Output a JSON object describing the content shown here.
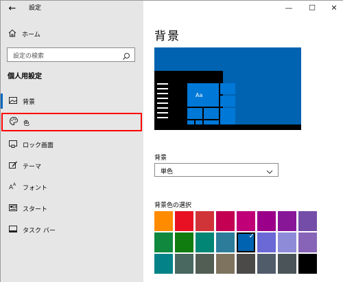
{
  "window": {
    "title": "設定",
    "back_glyph": "←",
    "controls": {
      "minimize": "—",
      "maximize": "☐",
      "close": "✕"
    }
  },
  "sidebar": {
    "home": {
      "label": "ホーム",
      "icon": "home-icon"
    },
    "search": {
      "placeholder": "設定の検索",
      "icon": "search-icon"
    },
    "section_title": "個人用設定",
    "items": [
      {
        "label": "背景",
        "icon": "picture-icon",
        "selected": true
      },
      {
        "label": "色",
        "icon": "palette-icon",
        "highlighted": true
      },
      {
        "label": "ロック画面",
        "icon": "lock-screen-icon"
      },
      {
        "label": "テーマ",
        "icon": "theme-brush-icon"
      },
      {
        "label": "フォント",
        "icon": "font-icon"
      },
      {
        "label": "スタート",
        "icon": "start-icon"
      },
      {
        "label": "タスク バー",
        "icon": "taskbar-icon"
      }
    ]
  },
  "main": {
    "page_title": "背景",
    "preview": {
      "tile_text": "Aa"
    },
    "background": {
      "label": "背景",
      "value": "単色",
      "icon": "chevron-down-icon"
    },
    "colors": {
      "label": "背景色の選択",
      "selected_index": 12,
      "swatches": [
        "#ff8c00",
        "#e81123",
        "#d13438",
        "#c30052",
        "#bf0077",
        "#9a0089",
        "#881798",
        "#744da9",
        "#10893e",
        "#107c10",
        "#018574",
        "#2d7d9a",
        "#0063b1",
        "#6b69d6",
        "#8e8cd8",
        "#8764b8",
        "#038387",
        "#486860",
        "#525e54",
        "#7e735f",
        "#4c4a48",
        "#515c6b",
        "#4a5459",
        "#000000"
      ]
    }
  },
  "colors": {
    "sidebar_bg": "#e6e6e6",
    "accent": "#0063b1",
    "highlight_border": "#ff0000"
  }
}
